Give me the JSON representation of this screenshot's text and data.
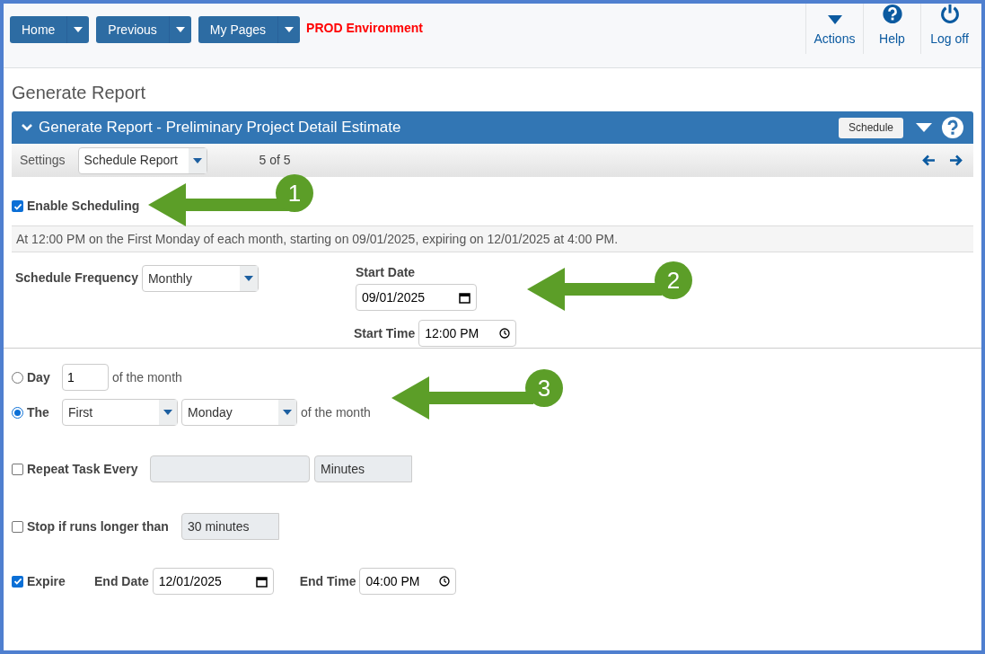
{
  "nav": {
    "buttons": [
      "Home",
      "Previous",
      "My Pages"
    ],
    "environment": "PROD Environment",
    "actions": [
      {
        "kind": "caret",
        "label": "Actions"
      },
      {
        "kind": "help",
        "label": "Help"
      },
      {
        "kind": "power",
        "label": "Log off"
      }
    ]
  },
  "page_title": "Generate Report",
  "panel": {
    "title": "Generate Report - Preliminary Project Detail Estimate",
    "button": "Schedule"
  },
  "toolbar": {
    "label": "Settings",
    "select": "Schedule Report",
    "counter": "5 of 5"
  },
  "enable_scheduling": {
    "label": "Enable Scheduling",
    "checked": true
  },
  "summary": "At 12:00 PM on the First Monday of each month, starting on 09/01/2025, expiring on 12/01/2025 at 4:00 PM.",
  "frequency": {
    "label": "Schedule Frequency",
    "value": "Monthly"
  },
  "start_date": {
    "label": "Start Date",
    "value": "09/01/2025"
  },
  "start_time": {
    "label": "Start Time",
    "value": "12:00 PM"
  },
  "day_option": {
    "label": "Day",
    "selected": false,
    "value": "1",
    "suffix": "of the month"
  },
  "the_option": {
    "label": "The",
    "selected": true,
    "ordinal": "First",
    "weekday": "Monday",
    "suffix": "of the month"
  },
  "repeat": {
    "label": "Repeat Task Every",
    "checked": false,
    "unit": "Minutes"
  },
  "stop": {
    "label": "Stop if runs longer than",
    "checked": false,
    "value": "30 minutes"
  },
  "expire": {
    "label": "Expire",
    "checked": true,
    "end_date_label": "End Date",
    "end_date": "12/01/2025",
    "end_time_label": "End Time",
    "end_time": "04:00 PM"
  },
  "callouts": [
    "1",
    "2",
    "3"
  ]
}
